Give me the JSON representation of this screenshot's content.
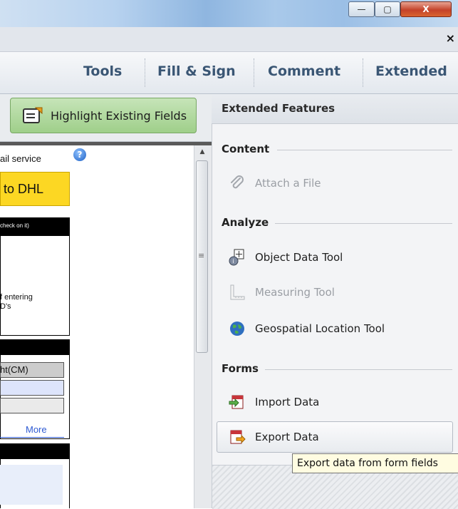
{
  "window": {
    "minimize_glyph": "—",
    "maximize_glyph": "▢",
    "close_glyph": "X",
    "doc_close_glyph": "×"
  },
  "toolbar": {
    "tabs": [
      {
        "label": "Tools"
      },
      {
        "label": "Fill & Sign"
      },
      {
        "label": "Comment"
      },
      {
        "label": "Extended"
      }
    ]
  },
  "left": {
    "highlight_button": "Highlight Existing Fields",
    "page_fragments": {
      "service": "ail service",
      "dhl_button": "to DHL",
      "black_header": "check on it)",
      "entering_1": "f entering",
      "entering_2": "D's",
      "table_header": "ht(CM)",
      "more_link": "More"
    }
  },
  "panel": {
    "title": "Extended Features",
    "sections": [
      {
        "name": "Content",
        "items": [
          {
            "label": "Attach a File",
            "icon": "paperclip-icon",
            "enabled": false
          }
        ]
      },
      {
        "name": "Analyze",
        "items": [
          {
            "label": "Object Data Tool",
            "icon": "object-data-icon",
            "enabled": true
          },
          {
            "label": "Measuring Tool",
            "icon": "ruler-icon",
            "enabled": false
          },
          {
            "label": "Geospatial Location Tool",
            "icon": "globe-icon",
            "enabled": true
          }
        ]
      },
      {
        "name": "Forms",
        "items": [
          {
            "label": "Import Data",
            "icon": "import-data-icon",
            "enabled": true
          },
          {
            "label": "Export Data",
            "icon": "export-data-icon",
            "enabled": true,
            "hovered": true
          }
        ]
      }
    ],
    "tooltip": "Export data from form fields"
  },
  "colors": {
    "highlight_green": "#a8d494",
    "dhl_yellow": "#fcd723",
    "tab_text": "#3a5674"
  }
}
